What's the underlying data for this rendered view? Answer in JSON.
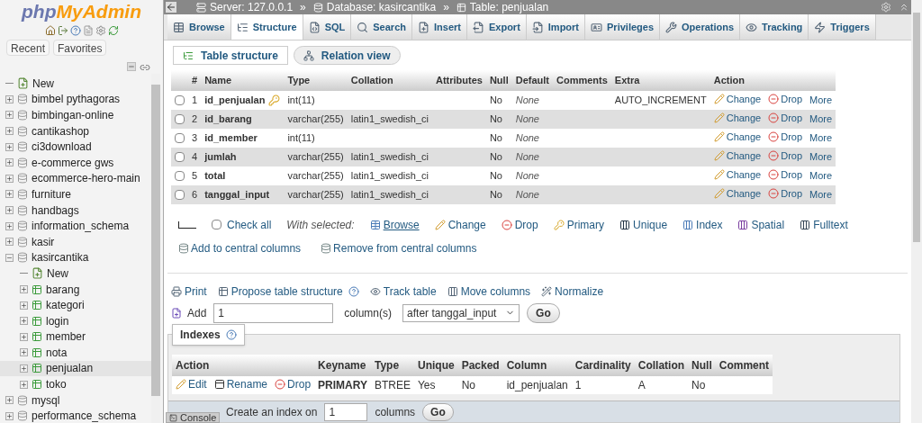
{
  "logo": [
    "php",
    "MyAdmin"
  ],
  "sidebar_buttons": [
    "Recent",
    "Favorites"
  ],
  "tree": [
    {
      "label": "New",
      "kind": "new",
      "selected": false
    },
    {
      "label": "bimbel pythagoras",
      "kind": "db",
      "expanded": false,
      "selected": false
    },
    {
      "label": "bimbingan-online",
      "kind": "db",
      "expanded": false,
      "selected": false
    },
    {
      "label": "cantikashop",
      "kind": "db",
      "expanded": false,
      "selected": false
    },
    {
      "label": "ci3download",
      "kind": "db",
      "expanded": false,
      "selected": false
    },
    {
      "label": "e-commerce gws",
      "kind": "db",
      "expanded": false,
      "selected": false
    },
    {
      "label": "ecommerce-hero-main",
      "kind": "db",
      "expanded": false,
      "selected": false
    },
    {
      "label": "furniture",
      "kind": "db",
      "expanded": false,
      "selected": false
    },
    {
      "label": "handbags",
      "kind": "db",
      "expanded": false,
      "selected": false
    },
    {
      "label": "information_schema",
      "kind": "db",
      "expanded": false,
      "selected": false
    },
    {
      "label": "kasir",
      "kind": "db",
      "expanded": false,
      "selected": false
    },
    {
      "label": "kasircantika",
      "kind": "db",
      "expanded": true,
      "selected": false,
      "children": [
        {
          "label": "New",
          "kind": "new",
          "selected": false
        },
        {
          "label": "barang",
          "kind": "table",
          "expanded": false,
          "selected": false
        },
        {
          "label": "kategori",
          "kind": "table",
          "expanded": false,
          "selected": false
        },
        {
          "label": "login",
          "kind": "table",
          "expanded": false,
          "selected": false
        },
        {
          "label": "member",
          "kind": "table",
          "expanded": false,
          "selected": false
        },
        {
          "label": "nota",
          "kind": "table",
          "expanded": false,
          "selected": false
        },
        {
          "label": "penjualan",
          "kind": "table",
          "expanded": false,
          "selected": true
        },
        {
          "label": "toko",
          "kind": "table",
          "expanded": false,
          "selected": false
        }
      ]
    },
    {
      "label": "mysql",
      "kind": "db",
      "expanded": false,
      "selected": false
    },
    {
      "label": "performance_schema",
      "kind": "db",
      "expanded": false,
      "selected": false
    }
  ],
  "breadcrumb": {
    "separator": "»",
    "items": [
      "Server: 127.0.0.1",
      "Database: kasircantika",
      "Table: penjualan"
    ]
  },
  "tabs": [
    {
      "label": "Browse",
      "selected": false
    },
    {
      "label": "Structure",
      "selected": true
    },
    {
      "label": "SQL",
      "selected": false
    },
    {
      "label": "Search",
      "selected": false
    },
    {
      "label": "Insert",
      "selected": false
    },
    {
      "label": "Export",
      "selected": false
    },
    {
      "label": "Import",
      "selected": false
    },
    {
      "label": "Privileges",
      "selected": false
    },
    {
      "label": "Operations",
      "selected": false
    },
    {
      "label": "Tracking",
      "selected": false
    },
    {
      "label": "Triggers",
      "selected": false
    }
  ],
  "subtabs": [
    {
      "label": "Table structure",
      "selected": true
    },
    {
      "label": "Relation view",
      "selected": false
    }
  ],
  "structure": {
    "columns": [
      "#",
      "Name",
      "Type",
      "Collation",
      "Attributes",
      "Null",
      "Default",
      "Comments",
      "Extra",
      "Action"
    ],
    "rows": [
      {
        "num": "1",
        "name": "id_penjualan",
        "key": true,
        "type": "int(11)",
        "collation": "",
        "null": "No",
        "default": "None",
        "extra": "AUTO_INCREMENT",
        "checked": false,
        "actions": [
          "Change",
          "Drop",
          "More"
        ]
      },
      {
        "num": "2",
        "name": "id_barang",
        "key": false,
        "type": "varchar(255)",
        "collation": "latin1_swedish_ci",
        "null": "No",
        "default": "None",
        "extra": "",
        "checked": false,
        "actions": [
          "Change",
          "Drop",
          "More"
        ]
      },
      {
        "num": "3",
        "name": "id_member",
        "key": false,
        "type": "int(11)",
        "collation": "",
        "null": "No",
        "default": "None",
        "extra": "",
        "checked": false,
        "actions": [
          "Change",
          "Drop",
          "More"
        ]
      },
      {
        "num": "4",
        "name": "jumlah",
        "key": false,
        "type": "varchar(255)",
        "collation": "latin1_swedish_ci",
        "null": "No",
        "default": "None",
        "extra": "",
        "checked": false,
        "actions": [
          "Change",
          "Drop",
          "More"
        ]
      },
      {
        "num": "5",
        "name": "total",
        "key": false,
        "type": "varchar(255)",
        "collation": "latin1_swedish_ci",
        "null": "No",
        "default": "None",
        "extra": "",
        "checked": false,
        "actions": [
          "Change",
          "Drop",
          "More"
        ]
      },
      {
        "num": "6",
        "name": "tanggal_input",
        "key": false,
        "type": "varchar(255)",
        "collation": "latin1_swedish_ci",
        "null": "No",
        "default": "None",
        "extra": "",
        "checked": false,
        "actions": [
          "Change",
          "Drop",
          "More"
        ]
      }
    ]
  },
  "bulk": {
    "check_all": "Check all",
    "checked": false,
    "with_selected": "With selected:",
    "actions": [
      "Browse",
      "Change",
      "Drop",
      "Primary",
      "Unique",
      "Index",
      "Spatial",
      "Fulltext"
    ],
    "central": [
      "Add to central columns",
      "Remove from central columns"
    ]
  },
  "tools": [
    "Print",
    "Propose table structure",
    "Track table",
    "Move columns",
    "Normalize"
  ],
  "add_columns": {
    "label": "Add",
    "value": "1",
    "unit": "column(s)",
    "position": "after tanggal_input",
    "go": "Go"
  },
  "indexes": {
    "title": "Indexes",
    "columns": [
      "Action",
      "Keyname",
      "Type",
      "Unique",
      "Packed",
      "Column",
      "Cardinality",
      "Collation",
      "Null",
      "Comment"
    ],
    "actions": [
      "Edit",
      "Rename",
      "Drop"
    ],
    "rows": [
      {
        "keyname": "PRIMARY",
        "type": "BTREE",
        "unique": "Yes",
        "packed": "No",
        "column": "id_penjualan",
        "cardinality": "1",
        "collation": "A",
        "null": "No",
        "comment": ""
      }
    ]
  },
  "create_index": {
    "label": "Create an index on",
    "value": "1",
    "unit": "columns",
    "go": "Go"
  },
  "console": "Console"
}
